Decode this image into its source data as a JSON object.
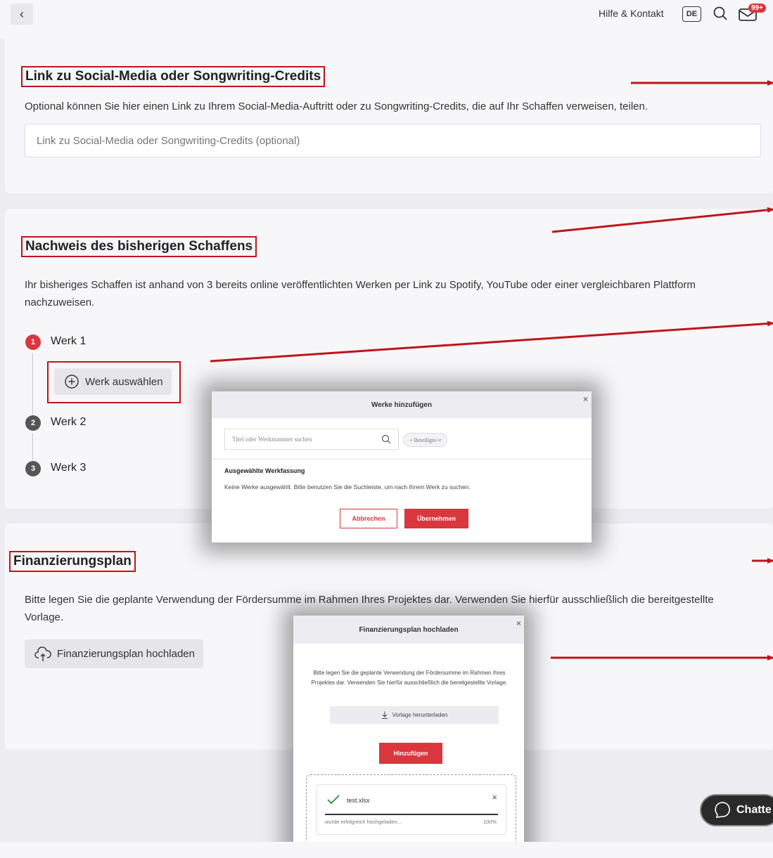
{
  "header": {
    "back_label": "‹",
    "help_label": "Hilfe & Kontakt",
    "language": "DE",
    "notifications_badge": "99+"
  },
  "section_social": {
    "title": "Link zu Social-Media oder Songwriting-Credits",
    "description": "Optional können Sie hier einen Link zu Ihrem Social-Media-Auftritt oder zu Songwriting-Credits, die auf Ihr Schaffen verweisen, teilen.",
    "input_placeholder": "Link zu Social-Media oder Songwriting-Credits (optional)"
  },
  "section_works": {
    "title": "Nachweis des bisherigen Schaffens",
    "description": "Ihr bisheriges Schaffen ist anhand von 3 bereits online veröffentlichten Werken per Link zu Spotify, YouTube oder einer vergleichbaren Plattform nachzuweisen.",
    "steps": [
      {
        "number": "1",
        "label": "Werk 1"
      },
      {
        "number": "2",
        "label": "Werk 2"
      },
      {
        "number": "3",
        "label": "Werk 3"
      }
    ],
    "select_button": "Werk auswählen"
  },
  "modal_works": {
    "title": "Werke hinzufügen",
    "close": "×",
    "search_placeholder": "Titel oder Werknummer suchen",
    "participant_button": "+ Beteiligte/-r",
    "selected_heading": "Ausgewählte Werkfassung",
    "empty_text": "Keine Werke ausgewählt. Bitte benutzen Sie die Suchleiste, um nach Ihrem Werk zu suchen.",
    "cancel_label": "Abbrechen",
    "confirm_label": "Übernehmen"
  },
  "section_finance": {
    "title": "Finanzierungsplan",
    "description": "Bitte legen Sie die geplante Verwendung der Fördersumme im Rahmen Ihres Projektes dar. Verwenden Sie hierfür ausschließlich die bereitgestellte Vorlage.",
    "upload_button": "Finanzierungsplan hochladen"
  },
  "modal_upload": {
    "title": "Finanzierungsplan hochladen",
    "close": "×",
    "description": "Bitte legen Sie die geplante Verwendung der Fördersumme im Rahmen Ihres Projektes dar. Verwenden Sie hierfür ausschließlich die bereitgestellte Vorlage.",
    "download_label": "Vorlage herunterladen",
    "add_label": "Hinzufügen",
    "file_name": "test.xlsx",
    "file_status": "wurde erfolgreich hochgeladen...",
    "progress_text": "100%",
    "progress": 1.0,
    "file_remove": "×"
  },
  "chat": {
    "label": "Chatte"
  },
  "colors": {
    "accent_red": "#d9363e",
    "annotation_red": "#c0141c",
    "page_bg": "#ececf1",
    "card_bg": "#f7f7f9"
  }
}
